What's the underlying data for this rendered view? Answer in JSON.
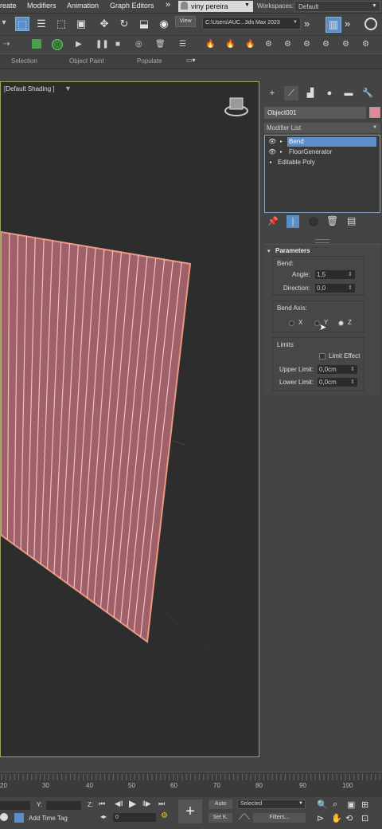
{
  "menubar": {
    "items": [
      "reate",
      "Modifiers",
      "Animation",
      "Graph Editors"
    ],
    "overflow": "»",
    "user": "viny pereira",
    "workspaces_label": "Workspaces:",
    "workspace": "Default"
  },
  "toolbar": {
    "view_label": "View",
    "path": "C:\\Users\\AUC...3ds Max 2023"
  },
  "ribbon": {
    "tabs": [
      "Selection",
      "Object Paint",
      "Populate"
    ]
  },
  "viewport": {
    "label": "[Default Shading ]"
  },
  "command_panel": {
    "object_name": "Object001",
    "object_color": "#e08a95",
    "modifier_list": "Modifier List",
    "stack": [
      {
        "label": "Bend",
        "active": true,
        "eye": true
      },
      {
        "label": "FloorGenerator",
        "active": false,
        "eye": true
      },
      {
        "label": "Editable Poly",
        "active": false,
        "eye": false
      }
    ]
  },
  "parameters": {
    "title": "Parameters",
    "bend_label": "Bend:",
    "angle_label": "Angle:",
    "angle_value": "1,5",
    "direction_label": "Direction:",
    "direction_value": "0,0",
    "bend_axis_label": "Bend Axis:",
    "axes": [
      "X",
      "Y",
      "Z"
    ],
    "selected_axis": "Z",
    "limits_label": "Limits",
    "limit_effect_label": "Limit Effect",
    "upper_limit_label": "Upper Limit:",
    "upper_limit_value": "0,0cm",
    "lower_limit_label": "Lower Limit:",
    "lower_limit_value": "0,0cm"
  },
  "timeline": {
    "ticks": [
      "20",
      "30",
      "40",
      "50",
      "60",
      "70",
      "80",
      "90",
      "100"
    ]
  },
  "bottombar": {
    "y_label": "Y:",
    "z_label": "Z:",
    "auto_label": "Auto",
    "setk_label": "Set K.",
    "selected_label": "Selected",
    "filters_label": "Filters...",
    "frame_value": "0",
    "add_time_tag": "Add Time Tag"
  }
}
